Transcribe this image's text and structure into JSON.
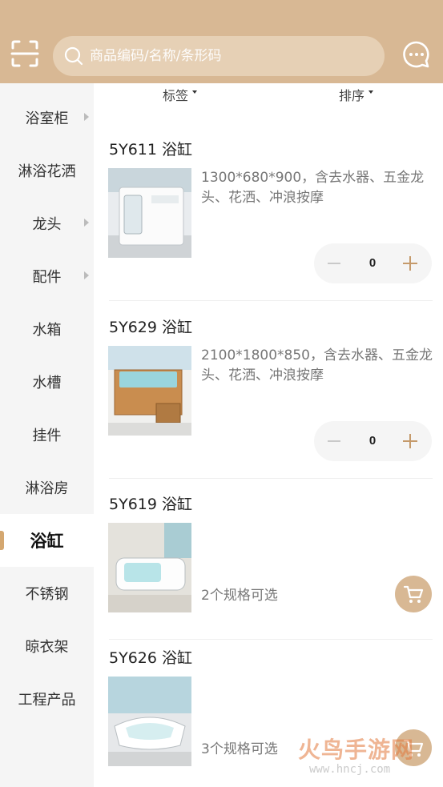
{
  "search": {
    "placeholder": "商品编码/名称/条形码"
  },
  "sidebar": {
    "items": [
      {
        "label": "浴室柜",
        "has_arrow": true,
        "active": false
      },
      {
        "label": "淋浴花洒",
        "has_arrow": false,
        "active": false
      },
      {
        "label": "龙头",
        "has_arrow": true,
        "active": false
      },
      {
        "label": "配件",
        "has_arrow": true,
        "active": false
      },
      {
        "label": "水箱",
        "has_arrow": false,
        "active": false
      },
      {
        "label": "水槽",
        "has_arrow": false,
        "active": false
      },
      {
        "label": "挂件",
        "has_arrow": false,
        "active": false
      },
      {
        "label": "淋浴房",
        "has_arrow": false,
        "active": false
      },
      {
        "label": "浴缸",
        "has_arrow": false,
        "active": true
      },
      {
        "label": "不锈钢",
        "has_arrow": false,
        "active": false
      },
      {
        "label": "晾衣架",
        "has_arrow": false,
        "active": false
      },
      {
        "label": "工程产品",
        "has_arrow": false,
        "active": false
      }
    ]
  },
  "filters": {
    "tag_label": "标签",
    "sort_label": "排序"
  },
  "products": [
    {
      "title": "5Y611 浴缸",
      "desc": "1300*680*900，含去水器、五金龙头、花洒、冲浪按摩",
      "quantity": "0"
    },
    {
      "title": "5Y629 浴缸",
      "desc": "2100*1800*850，含去水器、五金龙头、花洒、冲浪按摩",
      "quantity": "0"
    },
    {
      "title": "5Y619 浴缸",
      "spec": "2个规格可选"
    },
    {
      "title": "5Y626 浴缸",
      "spec": "3个规格可选"
    }
  ],
  "watermark": {
    "text": "火鸟手游网",
    "url": "www.hncj.com"
  },
  "colors": {
    "header": "#d8b894",
    "search_box": "#e6d0b5",
    "accent": "#d4a770",
    "sidebar_bg": "#f5f5f5"
  }
}
